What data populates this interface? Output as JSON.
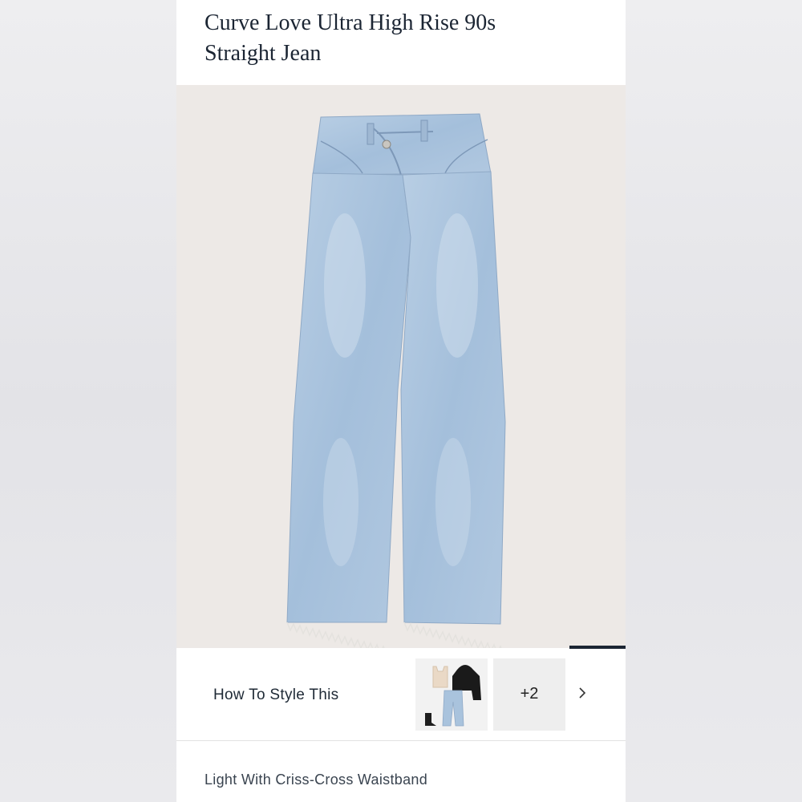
{
  "product": {
    "title_line1": "Curve Love Ultra High Rise 90s",
    "title_line2": "Straight Jean",
    "color_description": "Light With Criss-Cross Waistband"
  },
  "style_section": {
    "label": "How To Style This",
    "more_count": "+2"
  },
  "icons": {
    "chevron": "chevron-right-icon"
  },
  "colors": {
    "text_dark": "#1b2533",
    "hero_bg": "#ede9e6",
    "denim": "#a9c3dd"
  }
}
